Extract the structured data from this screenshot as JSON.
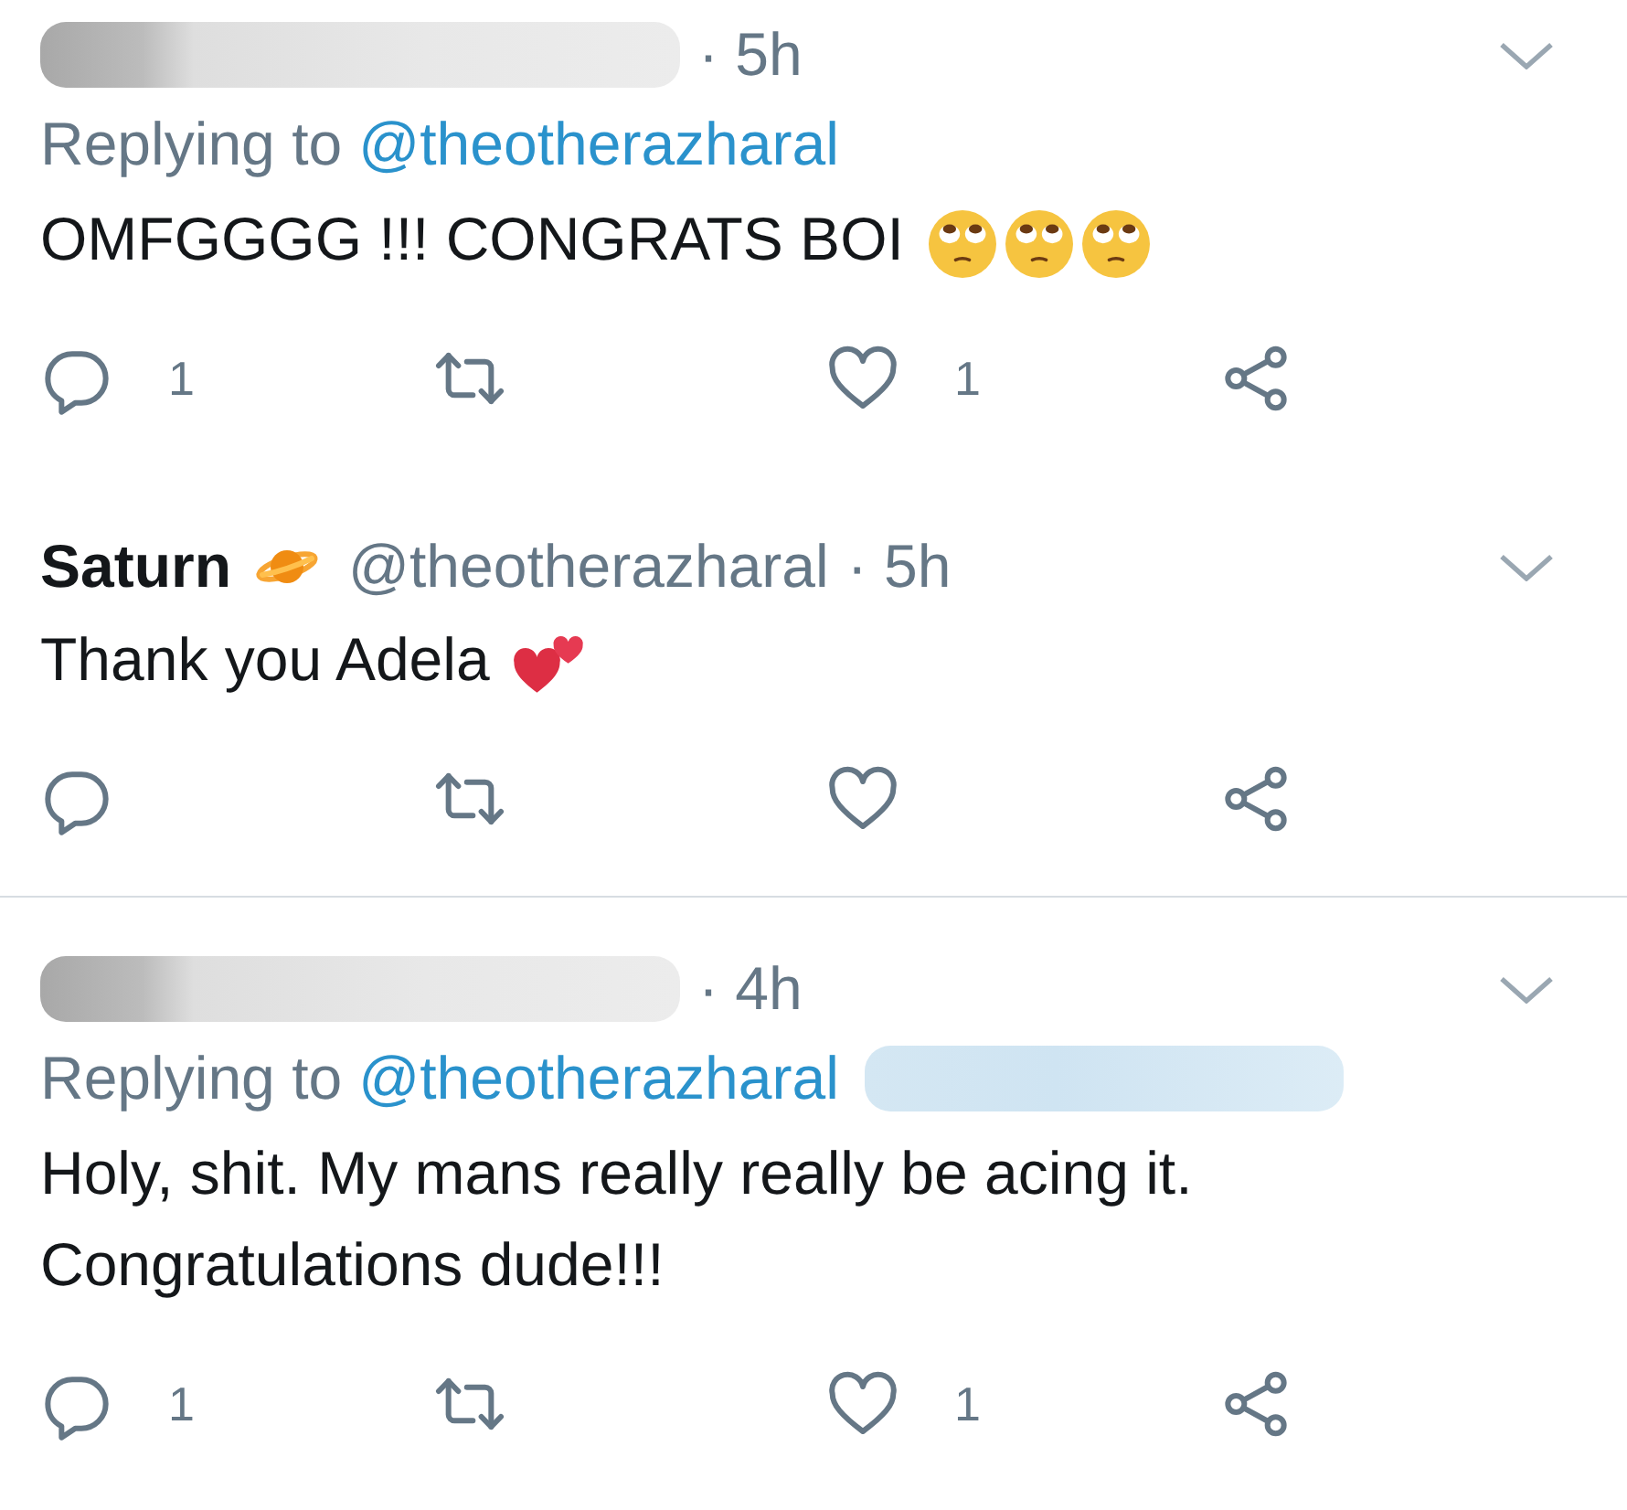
{
  "tweets": [
    {
      "author": {
        "kind": "redacted"
      },
      "time": "· 5h",
      "reply_to": {
        "label": "Replying to",
        "handle": "@theotherazharal",
        "blurred_mention": false
      },
      "body": {
        "text": "OMFGGGG !!! CONGRATS BOI",
        "emojis": [
          {
            "kind": "eye-roll-face"
          },
          {
            "kind": "eye-roll-face"
          },
          {
            "kind": "eye-roll-face"
          }
        ]
      },
      "actions": [
        {
          "kind": "reply",
          "count": "1"
        },
        {
          "kind": "retweet"
        },
        {
          "kind": "like",
          "count": "1"
        },
        {
          "kind": "share"
        }
      ],
      "divider_below": false
    },
    {
      "author": {
        "kind": "named",
        "name": "Saturn",
        "emoji": {
          "kind": "ringed-planet"
        },
        "handle": "@theotherazharal"
      },
      "time": "· 5h",
      "body": {
        "text": "Thank you Adela",
        "emojis": [
          {
            "kind": "two-hearts"
          }
        ]
      },
      "actions": [
        {
          "kind": "reply"
        },
        {
          "kind": "retweet"
        },
        {
          "kind": "like"
        },
        {
          "kind": "share"
        }
      ],
      "divider_below": true
    },
    {
      "author": {
        "kind": "redacted"
      },
      "time": "· 4h",
      "reply_to": {
        "label": "Replying to",
        "handle": "@theotherazharal",
        "blurred_mention": true
      },
      "body": {
        "text": "Holy, shit. My mans really really be acing it. Congratulations dude!!!"
      },
      "actions": [
        {
          "kind": "reply",
          "count": "1"
        },
        {
          "kind": "retweet"
        },
        {
          "kind": "like",
          "count": "1"
        },
        {
          "kind": "share"
        }
      ],
      "divider_below": false
    }
  ]
}
